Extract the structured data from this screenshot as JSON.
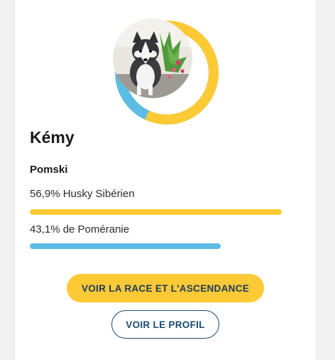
{
  "dog": {
    "name": "Kémy",
    "breed": "Pomski"
  },
  "ancestry": [
    {
      "label": "56,9% Husky Sibérien",
      "percent": 56.9,
      "color": "#fdc935"
    },
    {
      "label": "43,1% de Poméranie",
      "percent": 43.1,
      "color": "#5bbce4"
    }
  ],
  "buttons": {
    "breed_ancestry": "VOIR LA RACE ET L'ASCENDANCE",
    "profile": "VOIR LE PROFIL"
  }
}
